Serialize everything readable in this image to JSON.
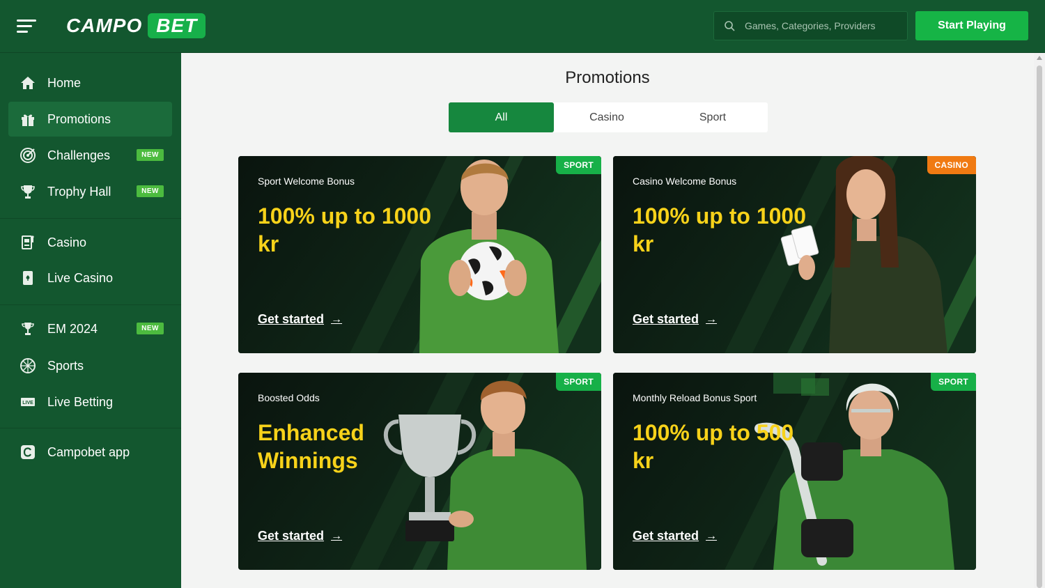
{
  "header": {
    "logo_left": "CAMPO",
    "logo_right": "BET",
    "search_placeholder": "Games, Categories, Providers",
    "start_label": "Start Playing"
  },
  "sidebar": {
    "items": [
      {
        "label": "Home",
        "icon": "home-icon"
      },
      {
        "label": "Promotions",
        "icon": "gift-icon"
      },
      {
        "label": "Challenges",
        "icon": "target-icon",
        "badge": "NEW"
      },
      {
        "label": "Trophy Hall",
        "icon": "trophy-icon",
        "badge": "NEW"
      },
      {
        "label": "Casino",
        "icon": "slot-machine-icon"
      },
      {
        "label": "Live Casino",
        "icon": "card-icon"
      },
      {
        "label": "EM 2024",
        "icon": "cup-icon",
        "badge": "NEW"
      },
      {
        "label": "Sports",
        "icon": "ball-icon"
      },
      {
        "label": "Live Betting",
        "icon": "live-icon"
      },
      {
        "label": "Campobet app",
        "icon": "app-icon"
      }
    ]
  },
  "main": {
    "title": "Promotions",
    "tabs": [
      "All",
      "Casino",
      "Sport"
    ],
    "active_tab": "All",
    "promos": [
      {
        "subtitle": "Sport Welcome Bonus",
        "title": "100% up to 1000 kr",
        "cta": "Get started",
        "tag": "SPORT"
      },
      {
        "subtitle": "Casino Welcome Bonus",
        "title": "100% up to 1000 kr",
        "cta": "Get started",
        "tag": "CASINO"
      },
      {
        "subtitle": "Boosted Odds",
        "title": "Enhanced Winnings",
        "cta": "Get started",
        "tag": "SPORT"
      },
      {
        "subtitle": "Monthly Reload Bonus Sport",
        "title": "100% up to 500 kr",
        "cta": "Get started",
        "tag": "SPORT"
      }
    ]
  },
  "colors": {
    "brand_green": "#13572f",
    "accent_green": "#16b446",
    "promo_yellow": "#f7d21a",
    "casino_orange": "#f07a12"
  }
}
